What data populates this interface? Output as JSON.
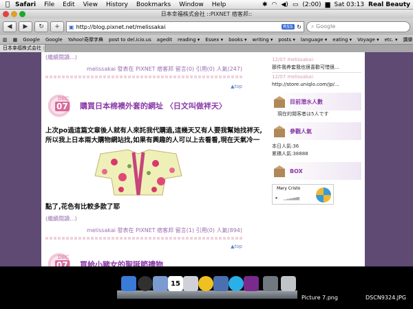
{
  "menubar": {
    "app": "Safari",
    "items": [
      "File",
      "Edit",
      "View",
      "History",
      "Bookmarks",
      "Window",
      "Help"
    ],
    "battery": "(2:00)",
    "clock": "Sat 03:13",
    "user": "Real Beauty"
  },
  "window": {
    "title": "日本幸福株式会社 ::PIXNET 痞客邦::",
    "url": "http://blog.pixnet.net/melissakai",
    "rss": "RSS",
    "search_placeholder": "Google",
    "bookmarks": [
      "Google",
      "Google",
      "Yahoo!奇摩字典",
      "post to del.icio.us",
      "agedit",
      "reading ▾",
      "Essex ▾",
      "books ▾",
      "writing ▾",
      "posts ▾",
      "language ▾",
      "eating ▾",
      "Voyage ▾",
      "etc. ▾",
      "讚樂 ▾"
    ],
    "tab": "日本幸福株式会社 ::PIXNET 痞..."
  },
  "blog": {
    "continue_reading": "(繼續閱讀...)",
    "top_label": "▲top",
    "post1_meta": "melissakai 發表在 PIXNET 痞客邦 留言(0) 引用(0) 人氣(247)",
    "post2": {
      "month": "DEC",
      "day": "07",
      "title": "購買日本棉襖外套的網址 〈日文叫做袢天〉",
      "body_line1": "上次po過這篇文章後人就有人來託我代購過,這幾天又有人要我幫她找袢天,",
      "body_line2": "所以我上日本兩大購物網站找,如果有興趣的人可以上去看看,現在天氣冷一",
      "body_line3": "點了,花色有比較多款了耶",
      "continue": "(繼續閱讀...)",
      "meta": "melissakai 發表在 PIXNET 痞客邦 留言(1) 引用(0) 人氣(894)"
    },
    "post3": {
      "month": "DEC",
      "day": "07",
      "title": "買給小豬女的聖誕節禮物"
    }
  },
  "sidebar": {
    "recent": [
      {
        "date": "12/07 melissakai:",
        "text": "那件我养套我也很喜歡可惜很..."
      },
      {
        "date": "12/07 melissakai:",
        "text": "http://store.uniqlo.com/jp/..."
      }
    ],
    "online_title": "目前潛水人數",
    "online_text": "現在的閱客者は5人です",
    "visitors_title": "參觀人氣",
    "today_label": "本日人氣:36",
    "total_label": "累積人氣:38888",
    "box_title": "BOX",
    "player_name": "Mary Cristo"
  },
  "dock": {
    "file1": "Picture 7.png",
    "file2": "DSCN9324.JPG",
    "calendar_day": "15"
  },
  "colors": {
    "accent_purple": "#8a3aa8",
    "link_purple": "#9a6bb0",
    "page_bg": "#5e4a72",
    "pink": "#d86a9a"
  }
}
